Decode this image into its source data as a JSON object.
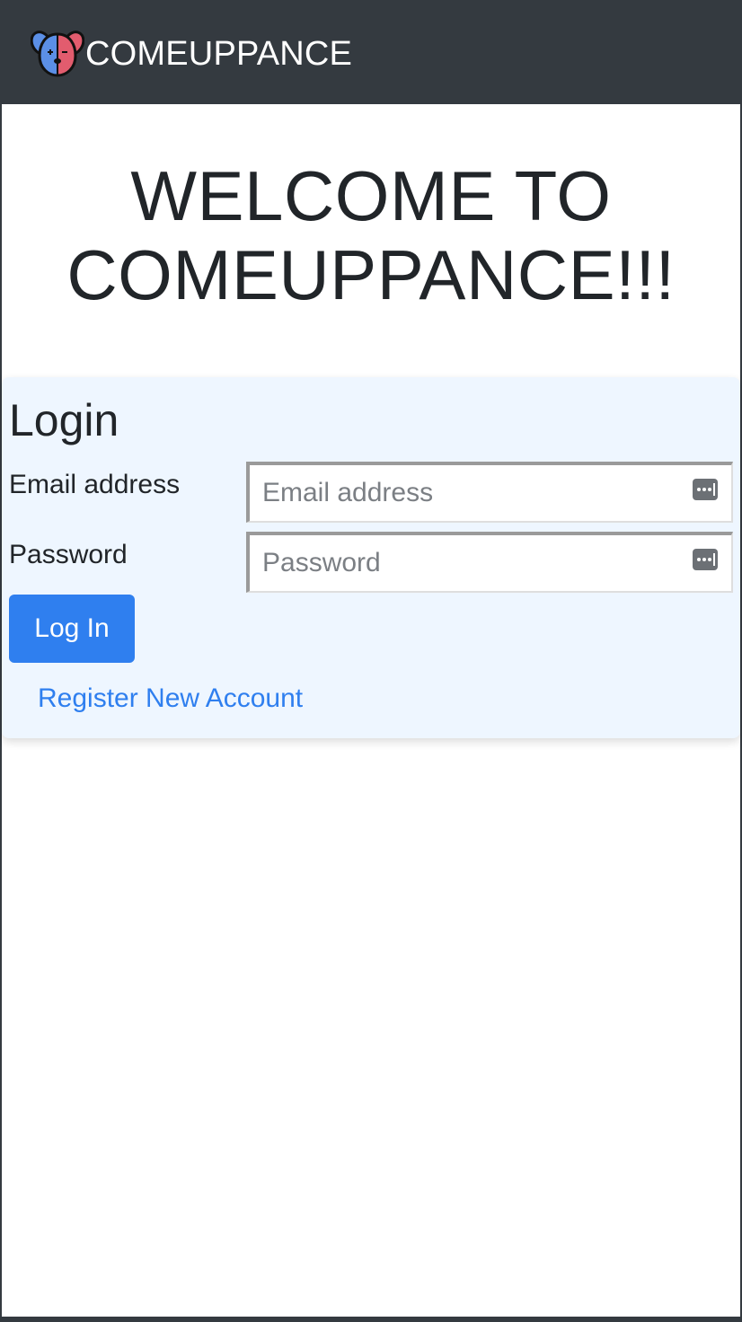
{
  "navbar": {
    "brand_text": "COMEUPPANCE",
    "logo_icon": "dog-face-logo-icon",
    "background": "#343a40"
  },
  "welcome": {
    "line1": "WELCOME TO",
    "line2": "COMEUPPANCE!!!"
  },
  "login": {
    "title": "Login",
    "email_label": "Email address",
    "email_placeholder": "Email address",
    "email_value": "",
    "password_label": "Password",
    "password_placeholder": "Password",
    "password_value": "",
    "autofill_icon": "password-manager-key-icon",
    "submit_label": "Log In",
    "register_link": "Register New Account",
    "card_background": "#eef6ff"
  },
  "colors": {
    "accent": "#2f7fef",
    "text": "#212529",
    "navbar": "#343a40"
  }
}
